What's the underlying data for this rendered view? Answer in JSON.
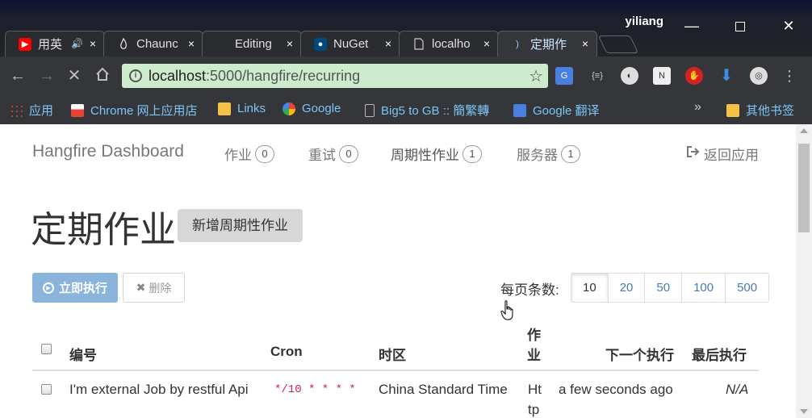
{
  "window": {
    "user": "yiliang",
    "minimize": "—",
    "close": "✕"
  },
  "tabs": [
    {
      "title": "用英",
      "icon": "youtube-icon",
      "color": "#ff0000",
      "audio": "🔊"
    },
    {
      "title": "Chaunc",
      "icon": "flame-icon",
      "color": "#2b2c30"
    },
    {
      "title": "Editing",
      "icon": "blank-icon",
      "color": "#2b2c30"
    },
    {
      "title": "NuGet",
      "icon": "nuget-icon",
      "color": "#004880"
    },
    {
      "title": "localho",
      "icon": "page-icon",
      "color": "#2b2c30"
    },
    {
      "title": "定期作",
      "icon": "loading-icon",
      "color": "#2b2c30"
    }
  ],
  "tab_close": "×",
  "omnibox": {
    "host": "localhost",
    "path": ":5000/hangfire/recurring"
  },
  "bookmarks": {
    "apps": "应用",
    "chrome_store": "Chrome 网上应用店",
    "links": "Links",
    "google": "Google",
    "big5": "Big5 to GB :: 簡繁轉",
    "translate": "Google 翻译",
    "more": "»",
    "other": "其他书签"
  },
  "nav": {
    "brand": "Hangfire Dashboard",
    "jobs": "作业",
    "jobs_count": "0",
    "retries": "重试",
    "retries_count": "0",
    "recurring": "周期性作业",
    "recurring_count": "1",
    "servers": "服务器",
    "servers_count": "1",
    "back": "返回应用"
  },
  "page": {
    "title": "定期作业",
    "add_button": "新增周期性作业",
    "exec_button": "立即执行",
    "delete_button": "删除",
    "page_size_label": "每页条数:",
    "page_sizes": [
      "10",
      "20",
      "50",
      "100",
      "500"
    ]
  },
  "table": {
    "headers": {
      "id": "编号",
      "cron": "Cron",
      "timezone": "时区",
      "job_line1": "作",
      "job_line2": "业",
      "next": "下一个执行",
      "last": "最后执行"
    },
    "rows": [
      {
        "id": "I'm external Job by restful Api",
        "cron": "*/10 * * * *",
        "timezone": "China Standard Time",
        "job_line1": "Ht",
        "job_line2": "tp",
        "next": "a few seconds ago",
        "last": "N/A"
      }
    ]
  }
}
